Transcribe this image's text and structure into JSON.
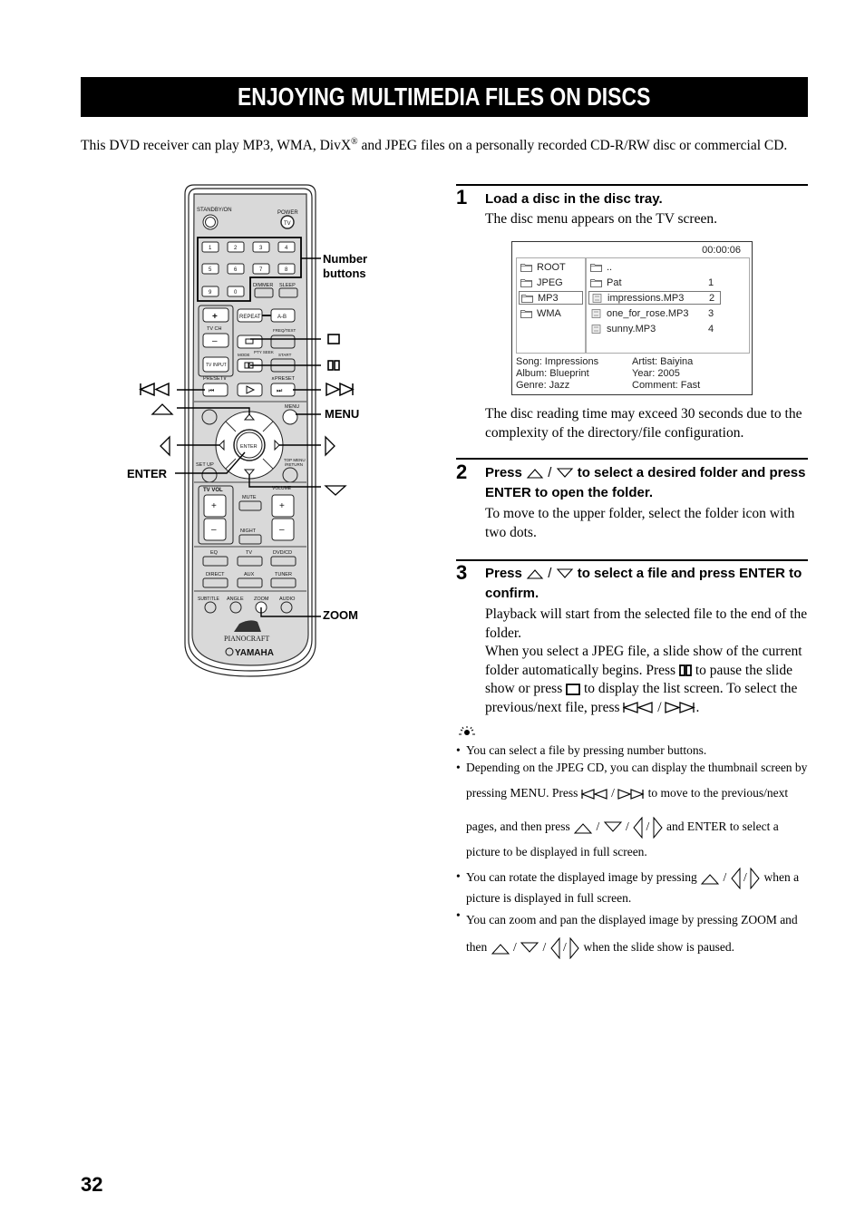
{
  "page": {
    "title": "ENJOYING MULTIMEDIA FILES ON DISCS",
    "intro_part1": "This DVD receiver can play MP3, WMA, DivX",
    "intro_reg": "®",
    "intro_part2": " and JPEG files on a personally recorded CD-R/RW disc or commercial CD.",
    "page_number": "32"
  },
  "remote": {
    "labels": {
      "standby": "STANDBY/ON",
      "power": "POWER",
      "tv": "TV",
      "numbers": [
        "1",
        "2",
        "3",
        "4",
        "5",
        "6",
        "7",
        "8",
        "9",
        "0"
      ],
      "dimmer": "DIMMER",
      "sleep": "SLEEP",
      "repeat": "REPEAT",
      "ab": "A-B",
      "tvch": "TV CH",
      "freqtext": "FREQ/TEXT",
      "mode": "MODE",
      "ptyseek": "PTY SEEK",
      "start": "START",
      "tvinput": "TV INPUT",
      "preset_down": "PRESET∨",
      "preset_up": "∧PRESET",
      "menu": "MENU",
      "enter": "ENTER",
      "setup": "SET UP",
      "topmenu1": "TOP MENU",
      "topmenu2": "/RETURN",
      "tvvol": "TV VOL",
      "volume": "VOLUME",
      "mute": "MUTE",
      "night": "NIGHT",
      "eq": "EQ",
      "tv2": "TV",
      "dvdcd": "DVD/CD",
      "direct": "DIRECT",
      "aux": "AUX",
      "tuner": "TUNER",
      "subtitle": "SUBTITLE",
      "angle": "ANGLE",
      "zoom": "ZOOM",
      "audio": "AUDIO",
      "brand_sub": "PIANOCRAFT",
      "brand": "YAMAHA"
    },
    "callouts": {
      "number_buttons_1": "Number",
      "number_buttons_2": "buttons",
      "menu": "MENU",
      "enter": "ENTER",
      "zoom": "ZOOM"
    }
  },
  "steps": [
    {
      "number": "1",
      "heading": "Load a disc in the disc tray.",
      "body": "The disc menu appears on the TV screen.",
      "note": "The disc reading time may exceed 30 seconds due to the complexity of the directory/file configuration."
    },
    {
      "number": "2",
      "heading_a": "Press",
      "heading_sep": "/",
      "heading_b": "to select a desired folder and press ENTER to open the folder.",
      "body": "To move to the upper folder, select the folder icon with two dots."
    },
    {
      "number": "3",
      "heading_a": "Press",
      "heading_sep": "/",
      "heading_b": "to select a file and press ENTER to confirm.",
      "body1": "Playback will start from the selected file to the end of the folder.",
      "body2a": "When you select a JPEG file, a slide show of the current folder automatically begins. Press",
      "body2b": "to pause the slide show or press",
      "body2c": "to display the list screen. To select the previous/next file, press",
      "body2d": "/",
      "body2e": "."
    }
  ],
  "disc_menu": {
    "time": "00:00:06",
    "folders": [
      "ROOT",
      "JPEG",
      "MP3",
      "WMA"
    ],
    "selected_folder": "MP3",
    "files": [
      {
        "name": "..",
        "type": "folder",
        "index": ""
      },
      {
        "name": "Pat",
        "type": "folder",
        "index": "1"
      },
      {
        "name": "impressions.MP3",
        "type": "mp3",
        "index": "2"
      },
      {
        "name": "one_for_rose.MP3",
        "type": "mp3",
        "index": "3"
      },
      {
        "name": "sunny.MP3",
        "type": "mp3",
        "index": "4"
      }
    ],
    "selected_file": "impressions.MP3",
    "info": {
      "song": "Song: Impressions",
      "album": "Album: Blueprint",
      "genre": "Genre: Jazz",
      "artist": "Artist: Baiyina",
      "year": "Year: 2005",
      "comment": "Comment: Fast"
    }
  },
  "tips": {
    "icon": "tip-lightbulb-icon",
    "items": [
      {
        "text": "You can select a file by pressing number buttons."
      },
      {
        "a": "Depending on the JPEG CD, you can display the thumbnail screen by pressing MENU. Press",
        "b": "/",
        "c": "to move to the previous/next pages, and then press",
        "d": "/",
        "e": "and ENTER to select a picture to be displayed in full screen."
      },
      {
        "a": "You can rotate the displayed image by pressing",
        "b": "/",
        "c": "when a picture is displayed in full screen."
      },
      {
        "a": "You can zoom and pan the displayed image by pressing ZOOM and then",
        "b": "/",
        "c": "when the slide show is paused."
      }
    ]
  }
}
